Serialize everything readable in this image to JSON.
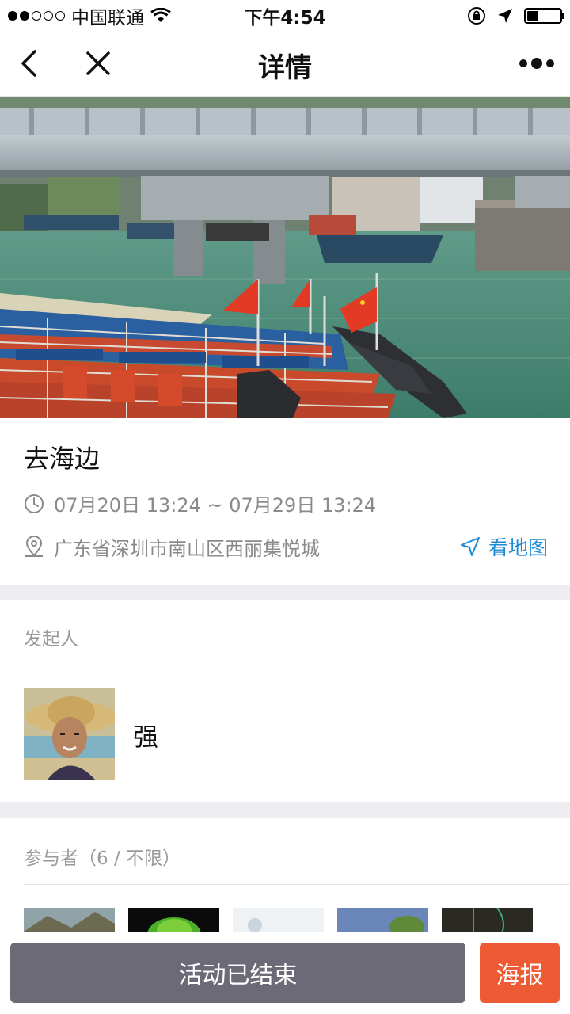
{
  "status_bar": {
    "carrier": "中国联通",
    "time": "下午4:54",
    "battery_level": 0.35
  },
  "nav": {
    "title": "详情"
  },
  "event": {
    "title": "去海边",
    "time_range": "07月20日 13:24 ~ 07月29日 13:24",
    "location": "广东省深圳市南山区西丽集悦城",
    "map_link": "看地图"
  },
  "organizer": {
    "section_label": "发起人",
    "name": "强"
  },
  "participants": {
    "section_label": "参与者（6 / 不限）"
  },
  "bottom": {
    "ended_label": "活动已结束",
    "poster_label": "海报"
  },
  "colors": {
    "accent_link": "#1d8ad9",
    "ended_button": "#6c6a77",
    "poster_button": "#ee5a34",
    "section_gap": "#eeedf2"
  }
}
